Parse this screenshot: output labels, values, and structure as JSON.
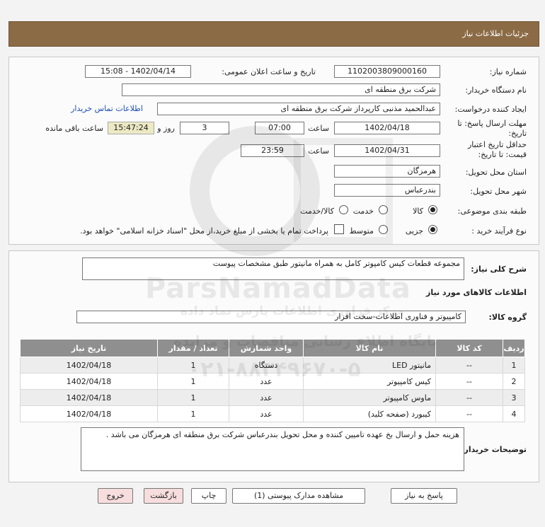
{
  "header": {
    "title": "جزئیات اطلاعات نیاز"
  },
  "form": {
    "need_number_label": "شماره نیاز:",
    "need_number": "1102003809000160",
    "announce_label": "تاریخ و ساعت اعلان عمومی:",
    "announce_value": "1402/04/14 - 15:08",
    "buyer_label": "نام دستگاه خریدار:",
    "buyer_value": "شرکت برق منطقه ای",
    "creator_label": "ایجاد کننده درخواست:",
    "creator_value": "عبدالحمید  مذنبی کارپرداز شرکت برق منطقه ای",
    "contact_link": "اطلاعات تماس خریدار",
    "deadline_label": "مهلت ارسال پاسخ: تا تاریخ:",
    "deadline_date": "1402/04/18",
    "time_label": "ساعت",
    "deadline_time": "07:00",
    "days_value": "3",
    "days_label": "روز و",
    "remaining_time": "15:47:24",
    "remaining_label": "ساعت باقی مانده",
    "validity_label": "حداقل تاریخ اعتبار قیمت: تا تاریخ:",
    "validity_date": "1402/04/31",
    "validity_time": "23:59",
    "province_label": "استان محل تحویل:",
    "province_value": "هرمزگان",
    "city_label": "شهر محل تحویل:",
    "city_value": "بندرعباس",
    "category_label": "طبقه بندی موضوعی:",
    "category_options": [
      "کالا",
      "خدمت",
      "کالا/خدمت"
    ],
    "category_selected": 0,
    "process_label": "نوع فرآیند خرید :",
    "process_options": [
      "جزیی",
      "متوسط"
    ],
    "process_selected": 0,
    "payment_note": "پرداخت تمام یا بخشی از مبلغ خرید،از محل \"اسناد خزانه اسلامی\" خواهد بود."
  },
  "summary": {
    "desc_label": "شرح کلی نیاز:",
    "desc_value": "مجموعه قطعات کیس کامپوتر کامل به همراه مانیتور طبق مشخصات پیوست",
    "goods_info_title": "اطلاعات کالاهای مورد نیاز",
    "group_label": "گروه کالا:",
    "group_value": "کامپیوتر و فناوری اطلاعات-سخت افزار"
  },
  "table": {
    "headers": [
      "ردیف",
      "کد کالا",
      "نام کالا",
      "واحد شمارش",
      "تعداد / مقدار",
      "تاریخ نیاز"
    ],
    "rows": [
      [
        "1",
        "--",
        "مانیتور LED",
        "دستگاه",
        "1",
        "1402/04/18"
      ],
      [
        "2",
        "--",
        "کیس کامپیوتر",
        "عدد",
        "1",
        "1402/04/18"
      ],
      [
        "3",
        "--",
        "ماوس کامپیوتر",
        "عدد",
        "1",
        "1402/04/18"
      ],
      [
        "4",
        "--",
        "کیبورد (صفحه کلید)",
        "عدد",
        "1",
        "1402/04/18"
      ]
    ]
  },
  "notes": {
    "label": "توضیحات خریدار:",
    "value": "هزینه حمل و ارسال بخ عهده تامیین کننده و محل تحویل بندرعباس شرکت برق منطقه ای هرمزگان می باشد ."
  },
  "buttons": {
    "reply": "پاسخ به نیاز",
    "attachments": "مشاهده مدارک پیوستی (1)",
    "print": "چاپ",
    "back": "بازگشت",
    "exit": "خروج"
  },
  "watermark": {
    "brand": "ParsNamadData",
    "persian_line1": "مرکز فراوری اطلاعات پارس نماد داده",
    "persian_line2": "پایگاه اطلاع رسانی مناقصات و مزایده",
    "phone": "۰۲۱-۸۸۳۴۹۶۷۰-۵"
  }
}
